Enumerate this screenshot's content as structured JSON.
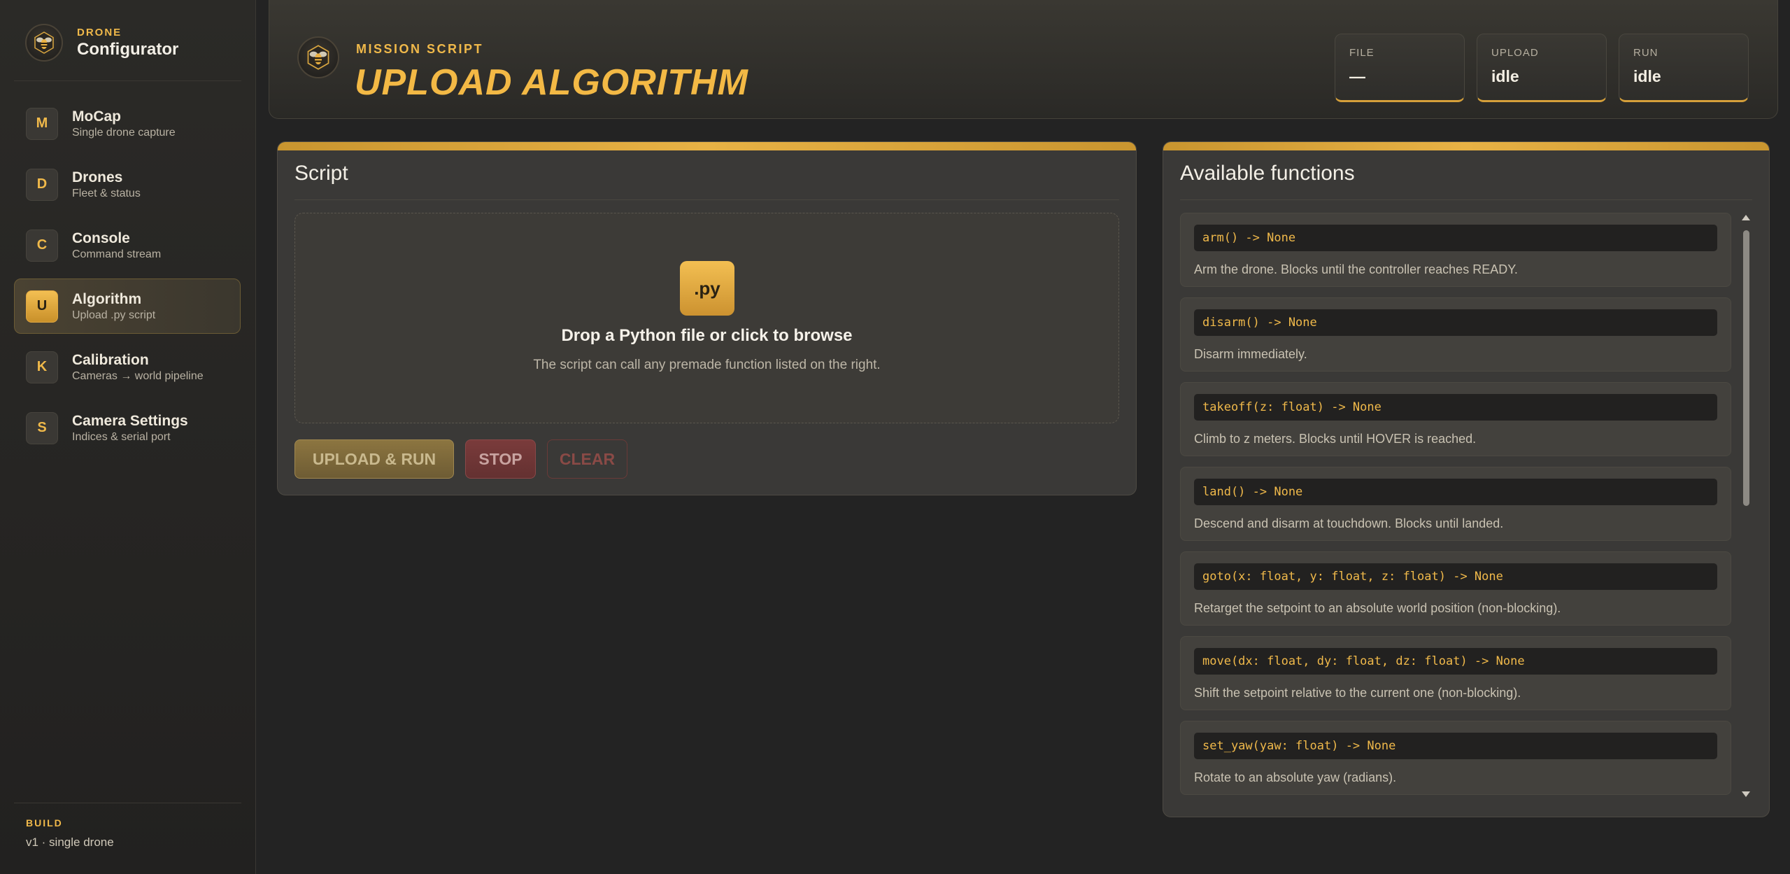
{
  "brand": {
    "kicker": "DRONE",
    "title": "Configurator"
  },
  "nav": [
    {
      "badge": "M",
      "label": "MoCap",
      "sub": "Single drone capture",
      "active": false
    },
    {
      "badge": "D",
      "label": "Drones",
      "sub": "Fleet & status",
      "active": false
    },
    {
      "badge": "C",
      "label": "Console",
      "sub": "Command stream",
      "active": false
    },
    {
      "badge": "U",
      "label": "Algorithm",
      "sub": "Upload .py script",
      "active": true
    },
    {
      "badge": "K",
      "label": "Calibration",
      "sub": "Cameras → world pipeline",
      "active": false
    },
    {
      "badge": "S",
      "label": "Camera Settings",
      "sub": "Indices & serial port",
      "active": false
    }
  ],
  "build": {
    "kicker": "BUILD",
    "value": "v1 · single drone"
  },
  "header": {
    "kicker": "MISSION SCRIPT",
    "title": "UPLOAD ALGORITHM",
    "stats": [
      {
        "label": "FILE",
        "value": "—"
      },
      {
        "label": "UPLOAD",
        "value": "idle"
      },
      {
        "label": "RUN",
        "value": "idle"
      }
    ]
  },
  "script_panel": {
    "title": "Script",
    "dropzone": {
      "badge": ".py",
      "title": "Drop a Python file or click to browse",
      "subtitle": "The script can call any premade function listed on the right."
    },
    "buttons": {
      "run": "UPLOAD & RUN",
      "stop": "STOP",
      "clear": "CLEAR"
    }
  },
  "functions_panel": {
    "title": "Available functions",
    "scroll_position": 0.0,
    "functions": [
      {
        "signature": "arm() -> None",
        "description": "Arm the drone. Blocks until the controller reaches READY."
      },
      {
        "signature": "disarm() -> None",
        "description": "Disarm immediately."
      },
      {
        "signature": "takeoff(z: float) -> None",
        "description": "Climb to z meters. Blocks until HOVER is reached."
      },
      {
        "signature": "land() -> None",
        "description": "Descend and disarm at touchdown. Blocks until landed."
      },
      {
        "signature": "goto(x: float, y: float, z: float) -> None",
        "description": "Retarget the setpoint to an absolute world position (non-blocking)."
      },
      {
        "signature": "move(dx: float, dy: float, dz: float) -> None",
        "description": "Shift the setpoint relative to the current one (non-blocking)."
      },
      {
        "signature": "set_yaw(yaw: float) -> None",
        "description": "Rotate to an absolute yaw (radians)."
      }
    ]
  },
  "colors": {
    "accent": "#f0b94a",
    "background": "#232323",
    "panel": "#3a3937",
    "danger": "#7a3b3b"
  }
}
